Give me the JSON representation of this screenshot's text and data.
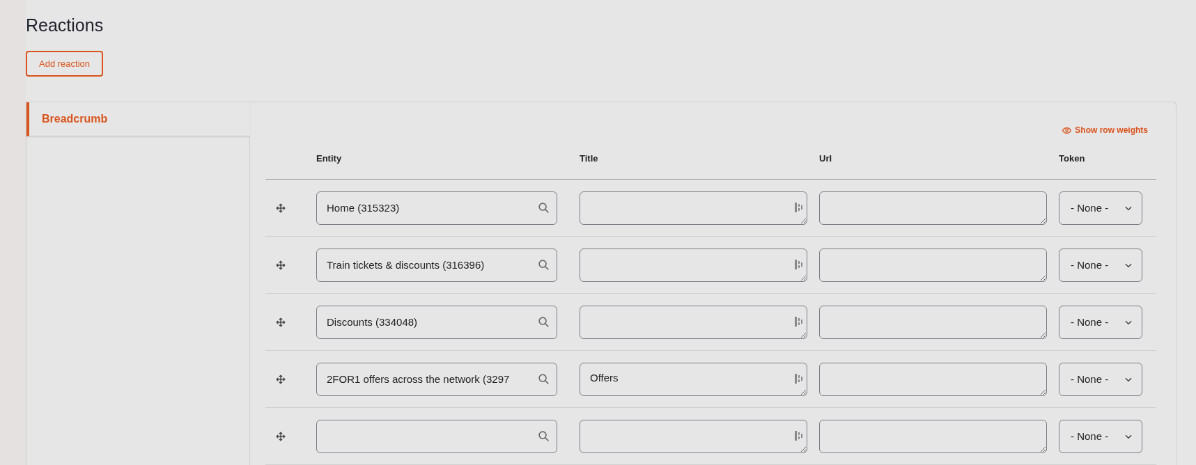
{
  "title": "Reactions",
  "add_button": "Add reaction",
  "tabs": [
    {
      "label": "Breadcrumb",
      "selected": true
    }
  ],
  "show_weights_link": "Show row weights",
  "columns": [
    "Entity",
    "Title",
    "Url",
    "Token"
  ],
  "rows": [
    {
      "entity": "Home (315323)",
      "title": "",
      "url": "",
      "token": "- None -"
    },
    {
      "entity": "Train tickets & discounts (316396)",
      "title": "",
      "url": "",
      "token": "- None -"
    },
    {
      "entity": "Discounts (334048)",
      "title": "",
      "url": "",
      "token": "- None -"
    },
    {
      "entity": "2FOR1 offers across the network (3297",
      "title": "Offers",
      "url": "",
      "token": "- None -"
    },
    {
      "entity": "",
      "title": "",
      "url": "",
      "token": "- None -"
    }
  ]
}
